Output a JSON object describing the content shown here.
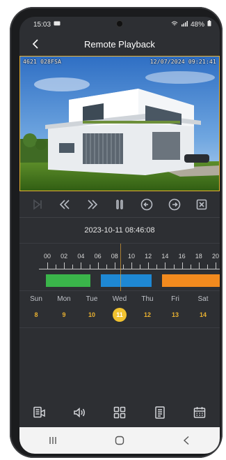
{
  "status_bar": {
    "time": "15:03",
    "battery": "48%"
  },
  "header": {
    "title": "Remote Playback",
    "back_icon": "chevron-left-icon"
  },
  "video": {
    "camera_label": "4621 028FSA",
    "overlay_datetime": "12/07/2024 09:21:41"
  },
  "controls": [
    {
      "name": "step-forward-button",
      "icon": "skip-next-icon",
      "enabled": false
    },
    {
      "name": "rewind-button",
      "icon": "rewind-icon",
      "enabled": true
    },
    {
      "name": "fast-forward-button",
      "icon": "fast-forward-icon",
      "enabled": true
    },
    {
      "name": "pause-button",
      "icon": "pause-icon",
      "enabled": true
    },
    {
      "name": "previous-button",
      "icon": "arrow-left-circle-icon",
      "enabled": true
    },
    {
      "name": "next-button",
      "icon": "arrow-right-circle-icon",
      "enabled": true
    },
    {
      "name": "close-stream-button",
      "icon": "close-box-icon",
      "enabled": true
    }
  ],
  "playback": {
    "current_time": "2023-10-11 08:46:08"
  },
  "timeline": {
    "hour_labels": [
      "00",
      "02",
      "04",
      "06",
      "08",
      "10",
      "12",
      "14",
      "16",
      "18",
      "20"
    ],
    "recording_segments": [
      {
        "type": "normal",
        "color": "#3ab54a"
      },
      {
        "type": "schedule",
        "color": "#1e88d4"
      },
      {
        "type": "alarm",
        "color": "#f28a1e"
      }
    ]
  },
  "week": {
    "days": [
      {
        "name": "Sun",
        "date": "8",
        "selected": false
      },
      {
        "name": "Mon",
        "date": "9",
        "selected": false
      },
      {
        "name": "Tue",
        "date": "10",
        "selected": false
      },
      {
        "name": "Wed",
        "date": "11",
        "selected": true
      },
      {
        "name": "Thu",
        "date": "12",
        "selected": false
      },
      {
        "name": "Fri",
        "date": "13",
        "selected": false
      },
      {
        "name": "Sat",
        "date": "14",
        "selected": false
      }
    ]
  },
  "toolbar": [
    {
      "name": "snapshot-button",
      "icon": "snapshot-icon"
    },
    {
      "name": "audio-button",
      "icon": "speaker-icon"
    },
    {
      "name": "split-view-button",
      "icon": "grid-icon"
    },
    {
      "name": "file-list-button",
      "icon": "list-document-icon"
    },
    {
      "name": "calendar-button",
      "icon": "calendar-icon"
    }
  ],
  "colors": {
    "accent": "#f2c330",
    "background": "#2d2f33"
  }
}
